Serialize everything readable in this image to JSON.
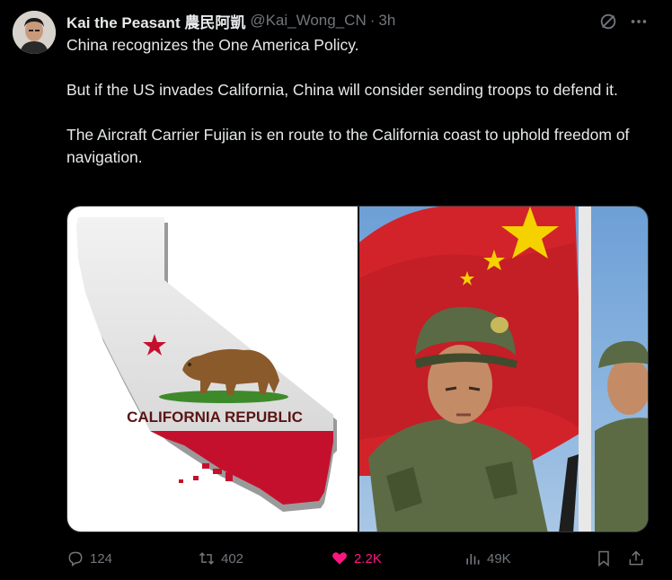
{
  "tweet": {
    "display_name": "Kai the Peasant 農民阿凱",
    "handle": "@Kai_Wong_CN",
    "separator": "·",
    "time": "3h",
    "paragraphs": [
      "China recognizes the One America Policy.",
      "But if the US invades California, China will consider sending troops to defend it.",
      "The Aircraft Carrier Fujian is en route to the California coast to uphold freedom of navigation."
    ],
    "media": {
      "left_image_text": "CALIFORNIA REPUBLIC"
    },
    "actions": {
      "replies": "124",
      "retweets": "402",
      "likes": "2.2K",
      "views": "49K"
    }
  },
  "icons": {
    "avatar": "user-avatar",
    "grok": "grok-icon",
    "more": "more-icon",
    "reply": "reply-icon",
    "retweet": "retweet-icon",
    "like": "heart-icon",
    "views": "views-icon",
    "bookmark": "bookmark-icon",
    "share": "share-icon"
  },
  "colors": {
    "background": "#000000",
    "text": "#e7e9ea",
    "muted": "#71767b",
    "like": "#f91880"
  }
}
